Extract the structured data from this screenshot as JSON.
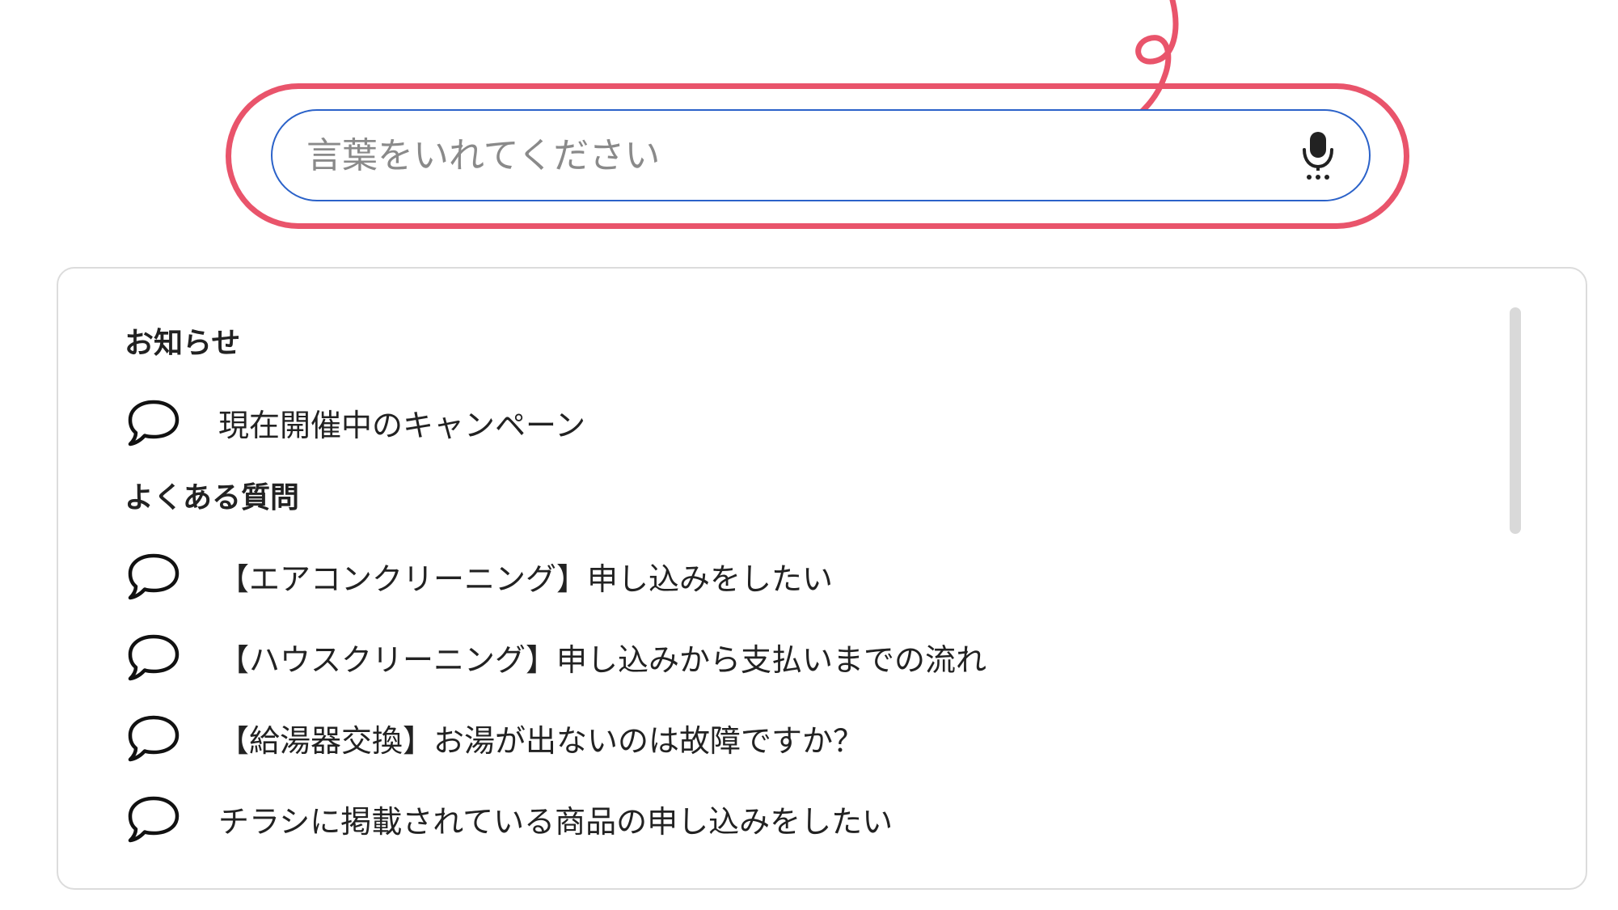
{
  "search": {
    "placeholder": "言葉をいれてください",
    "value": ""
  },
  "icons": {
    "mic": "microphone-icon",
    "suggestion": "speech-bubble-icon",
    "annotation": "arrow-icon"
  },
  "colors": {
    "highlight": "#e9546b",
    "search_border": "#2b62c9",
    "text": "#222222",
    "placeholder": "#8a8a8a"
  },
  "sections": [
    {
      "heading": "お知らせ",
      "items": [
        {
          "label": "現在開催中のキャンペーン"
        }
      ]
    },
    {
      "heading": "よくある質問",
      "items": [
        {
          "label": "【エアコンクリーニング】申し込みをしたい"
        },
        {
          "label": "【ハウスクリーニング】申し込みから支払いまでの流れ"
        },
        {
          "label": "【給湯器交換】お湯が出ないのは故障ですか？"
        },
        {
          "label": "チラシに掲載されている商品の申し込みをしたい"
        }
      ]
    }
  ]
}
